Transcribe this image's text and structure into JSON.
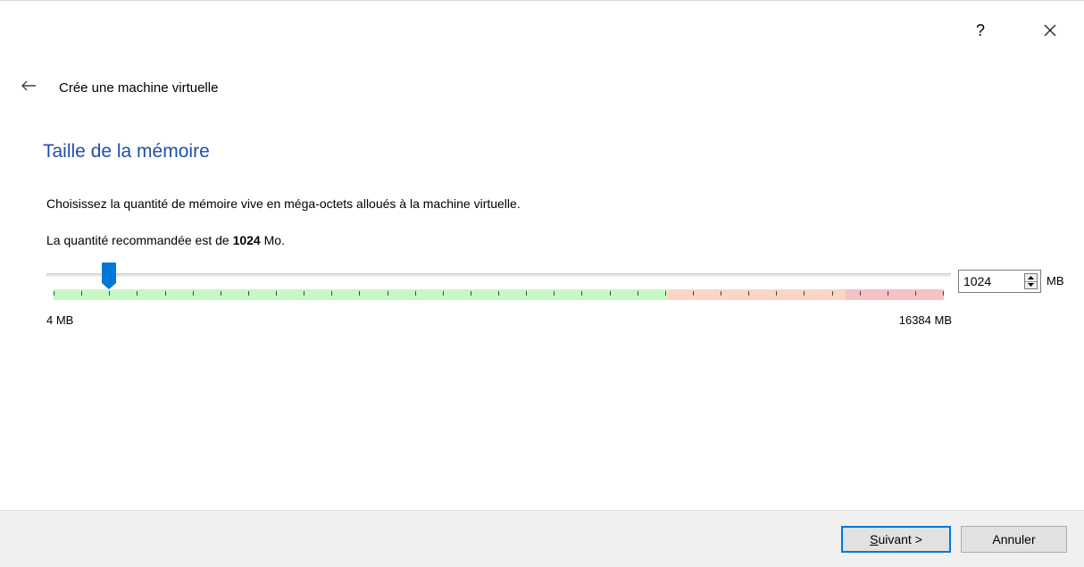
{
  "titlebar": {
    "help_label": "?",
    "help_icon": "question-mark-icon",
    "close_icon": "close-icon"
  },
  "header": {
    "back_icon": "back-arrow-icon",
    "wizard_title": "Crée une machine virtuelle"
  },
  "page": {
    "heading": "Taille de la mémoire",
    "description": "Choisissez la quantité de mémoire vive en méga-octets alloués à la machine virtuelle.",
    "recommendation_prefix": "La quantité recommandée est de ",
    "recommendation_value": "1024",
    "recommendation_suffix": " Mo."
  },
  "memory": {
    "min_label": "4 MB",
    "max_label": "16384 MB",
    "min": 4,
    "max": 16384,
    "value": 1024,
    "value_text": "1024",
    "unit": "MB",
    "safe_fraction": 0.69,
    "warning_fraction": 0.89,
    "tick_count": 33,
    "colors": {
      "safe": "#c6f7c4",
      "warning": "#fbd6c5",
      "danger": "#f6c2c4",
      "handle": "#0078d7",
      "heading": "#1f4fa8"
    }
  },
  "footer": {
    "next_label_mnemonic": "S",
    "next_label_rest": "uivant >",
    "cancel_label": "Annuler"
  }
}
